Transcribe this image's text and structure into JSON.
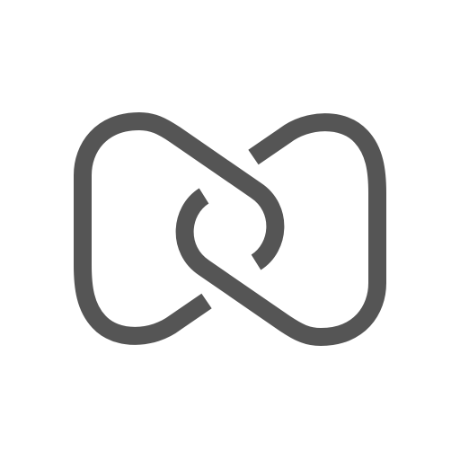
{
  "logo": {
    "icon": "interlocked-infinity-link-icon",
    "stroke_color": "#555555",
    "background_color": "#ffffff"
  }
}
